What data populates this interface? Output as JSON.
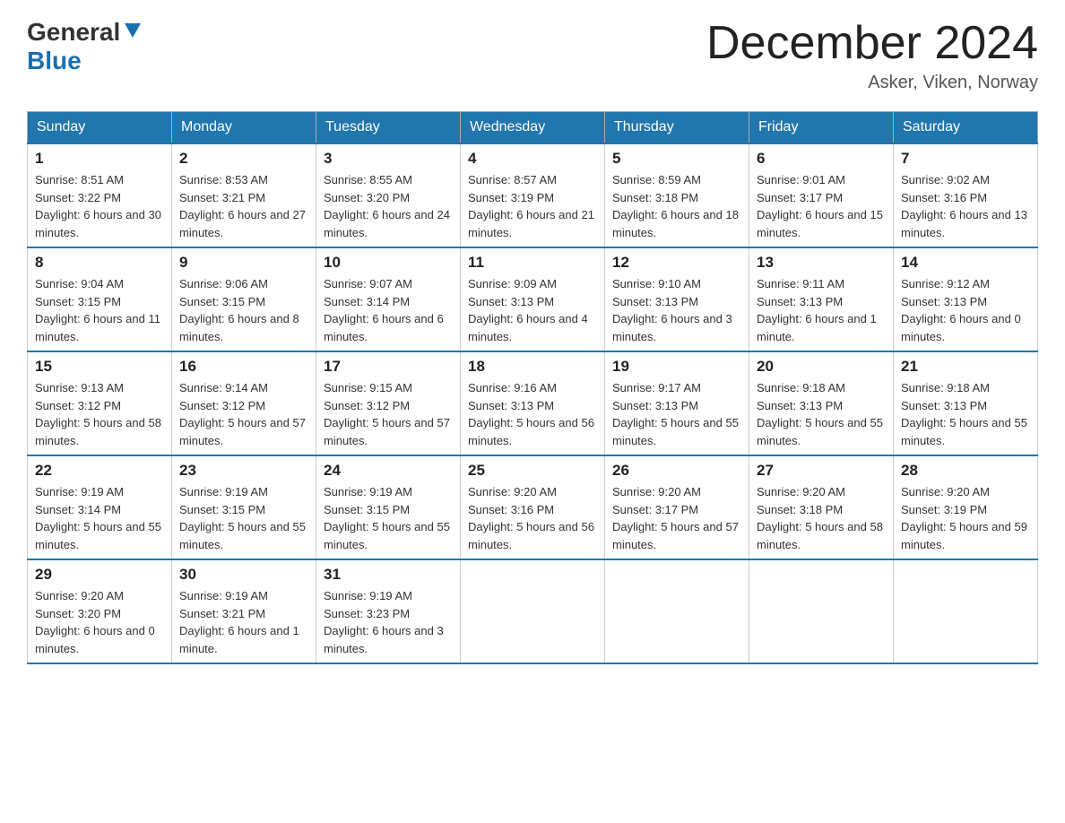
{
  "header": {
    "logo_general": "General",
    "logo_blue": "Blue",
    "month_title": "December 2024",
    "location": "Asker, Viken, Norway"
  },
  "days_of_week": [
    "Sunday",
    "Monday",
    "Tuesday",
    "Wednesday",
    "Thursday",
    "Friday",
    "Saturday"
  ],
  "weeks": [
    [
      {
        "day": "1",
        "sunrise": "8:51 AM",
        "sunset": "3:22 PM",
        "daylight": "6 hours and 30 minutes."
      },
      {
        "day": "2",
        "sunrise": "8:53 AM",
        "sunset": "3:21 PM",
        "daylight": "6 hours and 27 minutes."
      },
      {
        "day": "3",
        "sunrise": "8:55 AM",
        "sunset": "3:20 PM",
        "daylight": "6 hours and 24 minutes."
      },
      {
        "day": "4",
        "sunrise": "8:57 AM",
        "sunset": "3:19 PM",
        "daylight": "6 hours and 21 minutes."
      },
      {
        "day": "5",
        "sunrise": "8:59 AM",
        "sunset": "3:18 PM",
        "daylight": "6 hours and 18 minutes."
      },
      {
        "day": "6",
        "sunrise": "9:01 AM",
        "sunset": "3:17 PM",
        "daylight": "6 hours and 15 minutes."
      },
      {
        "day": "7",
        "sunrise": "9:02 AM",
        "sunset": "3:16 PM",
        "daylight": "6 hours and 13 minutes."
      }
    ],
    [
      {
        "day": "8",
        "sunrise": "9:04 AM",
        "sunset": "3:15 PM",
        "daylight": "6 hours and 11 minutes."
      },
      {
        "day": "9",
        "sunrise": "9:06 AM",
        "sunset": "3:15 PM",
        "daylight": "6 hours and 8 minutes."
      },
      {
        "day": "10",
        "sunrise": "9:07 AM",
        "sunset": "3:14 PM",
        "daylight": "6 hours and 6 minutes."
      },
      {
        "day": "11",
        "sunrise": "9:09 AM",
        "sunset": "3:13 PM",
        "daylight": "6 hours and 4 minutes."
      },
      {
        "day": "12",
        "sunrise": "9:10 AM",
        "sunset": "3:13 PM",
        "daylight": "6 hours and 3 minutes."
      },
      {
        "day": "13",
        "sunrise": "9:11 AM",
        "sunset": "3:13 PM",
        "daylight": "6 hours and 1 minute."
      },
      {
        "day": "14",
        "sunrise": "9:12 AM",
        "sunset": "3:13 PM",
        "daylight": "6 hours and 0 minutes."
      }
    ],
    [
      {
        "day": "15",
        "sunrise": "9:13 AM",
        "sunset": "3:12 PM",
        "daylight": "5 hours and 58 minutes."
      },
      {
        "day": "16",
        "sunrise": "9:14 AM",
        "sunset": "3:12 PM",
        "daylight": "5 hours and 57 minutes."
      },
      {
        "day": "17",
        "sunrise": "9:15 AM",
        "sunset": "3:12 PM",
        "daylight": "5 hours and 57 minutes."
      },
      {
        "day": "18",
        "sunrise": "9:16 AM",
        "sunset": "3:13 PM",
        "daylight": "5 hours and 56 minutes."
      },
      {
        "day": "19",
        "sunrise": "9:17 AM",
        "sunset": "3:13 PM",
        "daylight": "5 hours and 55 minutes."
      },
      {
        "day": "20",
        "sunrise": "9:18 AM",
        "sunset": "3:13 PM",
        "daylight": "5 hours and 55 minutes."
      },
      {
        "day": "21",
        "sunrise": "9:18 AM",
        "sunset": "3:13 PM",
        "daylight": "5 hours and 55 minutes."
      }
    ],
    [
      {
        "day": "22",
        "sunrise": "9:19 AM",
        "sunset": "3:14 PM",
        "daylight": "5 hours and 55 minutes."
      },
      {
        "day": "23",
        "sunrise": "9:19 AM",
        "sunset": "3:15 PM",
        "daylight": "5 hours and 55 minutes."
      },
      {
        "day": "24",
        "sunrise": "9:19 AM",
        "sunset": "3:15 PM",
        "daylight": "5 hours and 55 minutes."
      },
      {
        "day": "25",
        "sunrise": "9:20 AM",
        "sunset": "3:16 PM",
        "daylight": "5 hours and 56 minutes."
      },
      {
        "day": "26",
        "sunrise": "9:20 AM",
        "sunset": "3:17 PM",
        "daylight": "5 hours and 57 minutes."
      },
      {
        "day": "27",
        "sunrise": "9:20 AM",
        "sunset": "3:18 PM",
        "daylight": "5 hours and 58 minutes."
      },
      {
        "day": "28",
        "sunrise": "9:20 AM",
        "sunset": "3:19 PM",
        "daylight": "5 hours and 59 minutes."
      }
    ],
    [
      {
        "day": "29",
        "sunrise": "9:20 AM",
        "sunset": "3:20 PM",
        "daylight": "6 hours and 0 minutes."
      },
      {
        "day": "30",
        "sunrise": "9:19 AM",
        "sunset": "3:21 PM",
        "daylight": "6 hours and 1 minute."
      },
      {
        "day": "31",
        "sunrise": "9:19 AM",
        "sunset": "3:23 PM",
        "daylight": "6 hours and 3 minutes."
      },
      null,
      null,
      null,
      null
    ]
  ]
}
